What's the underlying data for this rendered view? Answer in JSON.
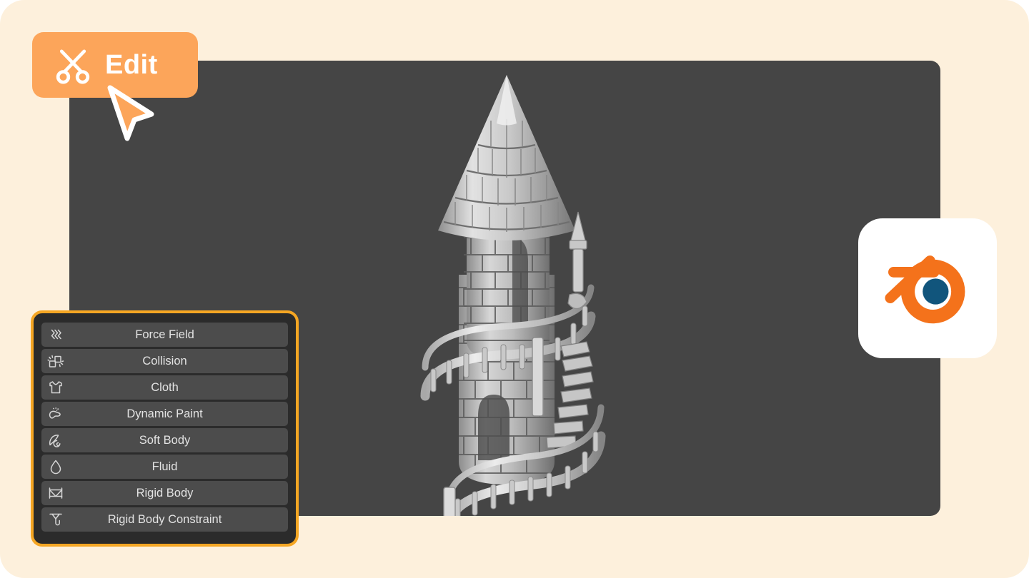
{
  "page": {
    "background_color": "#fdf0dc",
    "corner_radius_px": 34
  },
  "edit_badge": {
    "label": "Edit",
    "icon": "scissors-icon",
    "background_color": "#fca55a",
    "text_color": "#ffffff"
  },
  "cursor": {
    "icon": "mouse-pointer-icon",
    "fill_color": "#fca55a",
    "outline_color": "#ffffff"
  },
  "viewport": {
    "background_color": "#454545",
    "content": "3d-tower-model",
    "model_name": "stone tower with spiral staircase and conical roof"
  },
  "blender_card": {
    "icon": "blender-logo-icon",
    "background_color": "#ffffff",
    "brand_orange": "#f4721b",
    "brand_blue": "#11557c"
  },
  "physics_menu": {
    "border_color": "#f5a623",
    "background_color": "#2b2b2b",
    "row_color": "#4c4c4c",
    "text_color": "#e3e3e3",
    "items": [
      {
        "label": "Force Field",
        "icon": "force-field-icon"
      },
      {
        "label": "Collision",
        "icon": "collision-icon"
      },
      {
        "label": "Cloth",
        "icon": "cloth-icon"
      },
      {
        "label": "Dynamic Paint",
        "icon": "dynamic-paint-icon"
      },
      {
        "label": "Soft Body",
        "icon": "soft-body-icon"
      },
      {
        "label": "Fluid",
        "icon": "fluid-icon"
      },
      {
        "label": "Rigid Body",
        "icon": "rigid-body-icon"
      },
      {
        "label": "Rigid Body Constraint",
        "icon": "rigid-body-constraint-icon"
      }
    ]
  }
}
